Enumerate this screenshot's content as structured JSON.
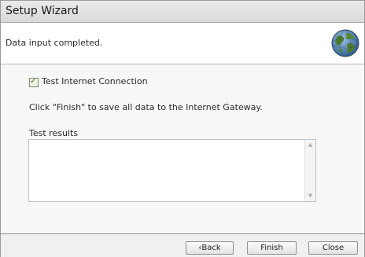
{
  "window": {
    "title": "Setup Wizard",
    "subtitle": "Data input completed."
  },
  "content": {
    "checkbox_label": "Test Internet Connection",
    "checkbox_checked": true,
    "instructions": "Click \"Finish\" to save all data to the Internet Gateway.",
    "results_label": "Test results",
    "results_value": ""
  },
  "footer": {
    "back_label": "‹Back",
    "finish_label": "Finish",
    "close_label": "Close"
  },
  "icons": {
    "header_icon": "globe-icon",
    "checkbox_mark": "checkmark-icon"
  },
  "colors": {
    "title_bar": "#dcdcdc",
    "panel_bg": "#f7f7f7",
    "check_green": "#3e7a1e"
  }
}
